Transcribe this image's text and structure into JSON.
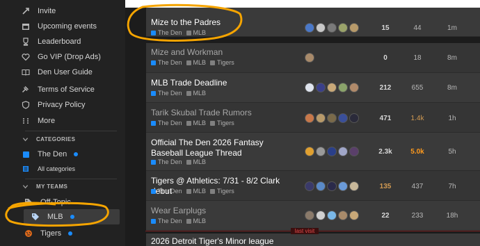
{
  "sidebar": {
    "items": [
      {
        "label": "Invite",
        "icon": "invite-icon"
      },
      {
        "label": "Upcoming events",
        "icon": "calendar-icon"
      },
      {
        "label": "Leaderboard",
        "icon": "trophy-icon"
      },
      {
        "label": "Go VIP (Drop Ads)",
        "icon": "heart-icon"
      },
      {
        "label": "Den User Guide",
        "icon": "book-icon"
      },
      {
        "label": "Terms of Service",
        "icon": "gavel-icon"
      },
      {
        "label": "Privacy Policy",
        "icon": "shield-icon"
      },
      {
        "label": "More",
        "icon": "more-icon"
      }
    ],
    "categories_header": "CATEGORIES",
    "categories": [
      {
        "label": "The Den",
        "color": "#1a8cff"
      }
    ],
    "all_categories": "All categories",
    "teams_header": "MY TEAMS",
    "teams": [
      {
        "label": "Off-Topic",
        "color": "#808080"
      },
      {
        "label": "MLB",
        "color": "#1a8cff"
      },
      {
        "label": "Tigers",
        "color": "#1a8cff"
      }
    ]
  },
  "topics": [
    {
      "title": "Mize to the Padres",
      "visited": false,
      "tags": [
        "The Den",
        "MLB"
      ],
      "replies": "15",
      "views": "44",
      "activity": "1m"
    },
    {
      "title": "Mize and Workman",
      "visited": true,
      "tags": [
        "The Den",
        "MLB",
        "Tigers"
      ],
      "replies": "0",
      "views": "18",
      "activity": "8m"
    },
    {
      "title": "MLB Trade Deadline",
      "visited": false,
      "tags": [
        "The Den",
        "MLB"
      ],
      "replies": "212",
      "views": "655",
      "activity": "8m"
    },
    {
      "title": "Tarik Skubal Trade Rumors",
      "visited": true,
      "tags": [
        "The Den",
        "MLB",
        "Tigers"
      ],
      "replies": "471",
      "views": "1.4k",
      "activity": "1h"
    },
    {
      "title": "Official The Den 2026 Fantasy Baseball League Thread",
      "visited": false,
      "tags": [
        "The Den",
        "MLB"
      ],
      "replies": "2.3k",
      "views": "5.0k",
      "activity": "5h"
    },
    {
      "title": "Tigers @ Athletics: 7/31 - 8/2 Clark debut",
      "visited": false,
      "tags": [
        "The Den",
        "MLB",
        "Tigers"
      ],
      "replies": "135",
      "views": "437",
      "activity": "7h"
    },
    {
      "title": "Wear Earplugs",
      "visited": true,
      "tags": [
        "The Den",
        "MLB"
      ],
      "replies": "22",
      "views": "233",
      "activity": "18h"
    },
    {
      "title": "2026 Detroit Tiger's Minor league",
      "visited": false,
      "tags": [],
      "replies": "",
      "views": "",
      "activity": ""
    }
  ],
  "last_visit_label": "last visit",
  "colors": {
    "category_blue": "#1a8cff",
    "tag_gray": "#808080",
    "annotation_orange": "#f5a400"
  }
}
